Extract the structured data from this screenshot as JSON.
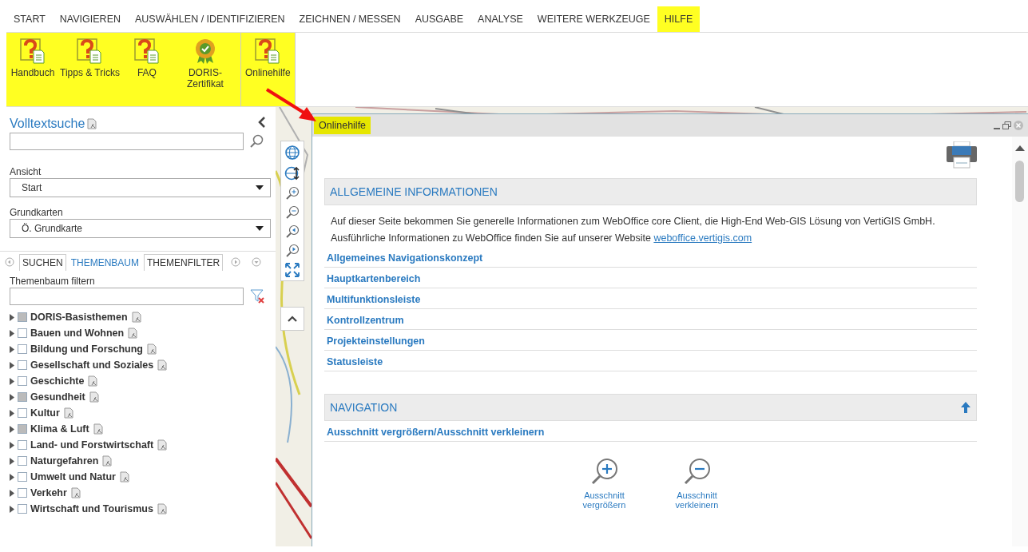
{
  "menu": [
    {
      "label": "START",
      "selected": false
    },
    {
      "label": "NAVIGIEREN",
      "selected": false
    },
    {
      "label": "AUSWÄHLEN / IDENTIFIZIEREN",
      "selected": false
    },
    {
      "label": "ZEICHNEN / MESSEN",
      "selected": false
    },
    {
      "label": "AUSGABE",
      "selected": false
    },
    {
      "label": "ANALYSE",
      "selected": false
    },
    {
      "label": "WEITERE WERKZEUGE",
      "selected": false
    },
    {
      "label": "HILFE",
      "selected": true
    }
  ],
  "ribbon": {
    "highlighted": true,
    "groups": [
      [
        {
          "label": "Handbuch",
          "kind": "help"
        },
        {
          "label": "Tipps & Tricks",
          "kind": "help"
        },
        {
          "label": "FAQ",
          "kind": "help"
        },
        {
          "label": "DORIS-Zertifikat",
          "kind": "certificate"
        }
      ],
      [
        {
          "label": "Onlinehilfe",
          "kind": "help"
        }
      ]
    ]
  },
  "sidebar": {
    "search_title": "Volltextsuche",
    "dropdowns": [
      {
        "label": "Ansicht",
        "value": "Start"
      },
      {
        "label": "Grundkarten",
        "value": "Ö. Grundkarte"
      }
    ],
    "tabs": [
      {
        "label": "SUCHEN",
        "selected": false
      },
      {
        "label": "THEMENBAUM",
        "selected": true
      },
      {
        "label": "THEMENFILTER",
        "selected": false
      }
    ],
    "filter_label": "Themenbaum filtern",
    "tree": [
      {
        "label": "DORIS-Basisthemen",
        "partial": true
      },
      {
        "label": "Bauen und Wohnen",
        "partial": false
      },
      {
        "label": "Bildung und Forschung",
        "partial": false
      },
      {
        "label": "Gesellschaft und Soziales",
        "partial": false
      },
      {
        "label": "Geschichte",
        "partial": false
      },
      {
        "label": "Gesundheit",
        "partial": true
      },
      {
        "label": "Kultur",
        "partial": false
      },
      {
        "label": "Klima & Luft",
        "partial": true
      },
      {
        "label": "Land- und Forstwirtschaft",
        "partial": false
      },
      {
        "label": "Naturgefahren",
        "partial": false
      },
      {
        "label": "Umwelt und Natur",
        "partial": false
      },
      {
        "label": "Verkehr",
        "partial": false
      },
      {
        "label": "Wirtschaft und Tourismus",
        "partial": false
      }
    ]
  },
  "dialog": {
    "title": "Onlinehilfe",
    "title_highlighted": true,
    "sections": [
      {
        "heading": "ALLGEMEINE INFORMATIONEN",
        "back_to_top": false,
        "text": "Auf dieser Seite bekommen Sie generelle Informationen zum WebOffice core Client, die High-End Web-GIS Lösung von VertiGIS GmbH.",
        "text2": "Ausführliche Informationen zu WebOffice finden Sie auf unserer Website",
        "link": "weboffice.vertigis.com",
        "topics": [
          "Allgemeines Navigationskonzept",
          "Hauptkartenbereich",
          "Multifunktionsleiste",
          "Kontrollzentrum",
          "Projekteinstellungen",
          "Statusleiste"
        ]
      },
      {
        "heading": "NAVIGATION",
        "back_to_top": true,
        "topics": [
          "Ausschnitt vergrößern/Ausschnitt verkleinern"
        ],
        "tools": [
          {
            "label": "Ausschnitt vergrößern",
            "kind": "zoom-in"
          },
          {
            "label": "Ausschnitt verkleinern",
            "kind": "zoom-out"
          }
        ]
      }
    ]
  }
}
